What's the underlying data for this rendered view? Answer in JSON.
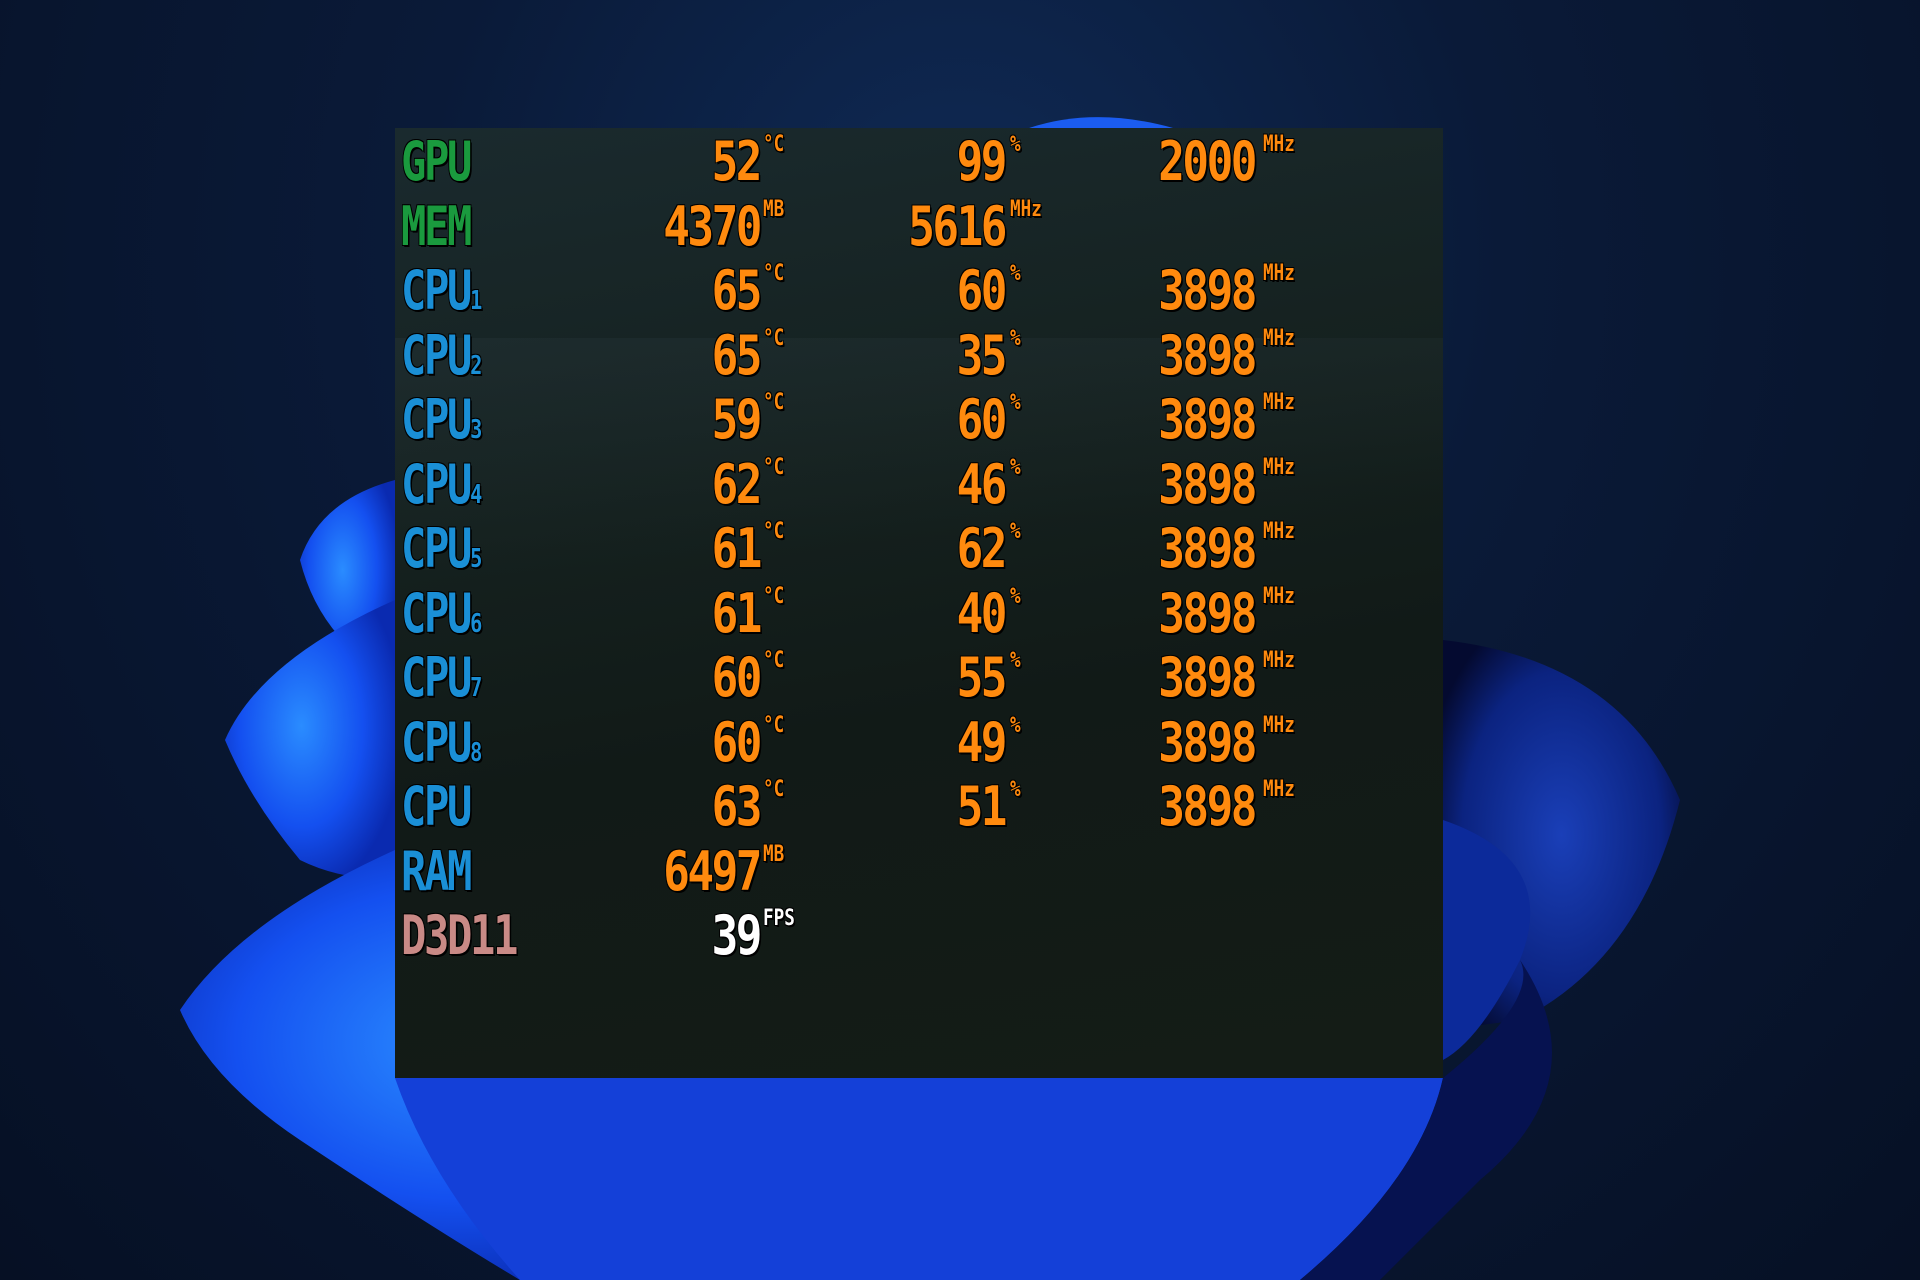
{
  "colors": {
    "gpu_label": "#1a9a3e",
    "cpu_label": "#1a8fd6",
    "api_label": "#c98a86",
    "value": "#ff8a0e",
    "fps_value": "#ffffff"
  },
  "overlay": {
    "rows": [
      {
        "label": "GPU",
        "sub": "",
        "v1": "52",
        "u1": "°C",
        "v2": "99",
        "u2": "%",
        "v3": "2000",
        "u3": "MHz",
        "color": "green"
      },
      {
        "label": "MEM",
        "sub": "",
        "v1": "4370",
        "u1": "MB",
        "v2": "5616",
        "u2": "MHz",
        "v3": "",
        "u3": "",
        "color": "green"
      },
      {
        "label": "CPU",
        "sub": "1",
        "v1": "65",
        "u1": "°C",
        "v2": "60",
        "u2": "%",
        "v3": "3898",
        "u3": "MHz",
        "color": "blue"
      },
      {
        "label": "CPU",
        "sub": "2",
        "v1": "65",
        "u1": "°C",
        "v2": "35",
        "u2": "%",
        "v3": "3898",
        "u3": "MHz",
        "color": "blue"
      },
      {
        "label": "CPU",
        "sub": "3",
        "v1": "59",
        "u1": "°C",
        "v2": "60",
        "u2": "%",
        "v3": "3898",
        "u3": "MHz",
        "color": "blue"
      },
      {
        "label": "CPU",
        "sub": "4",
        "v1": "62",
        "u1": "°C",
        "v2": "46",
        "u2": "%",
        "v3": "3898",
        "u3": "MHz",
        "color": "blue"
      },
      {
        "label": "CPU",
        "sub": "5",
        "v1": "61",
        "u1": "°C",
        "v2": "62",
        "u2": "%",
        "v3": "3898",
        "u3": "MHz",
        "color": "blue"
      },
      {
        "label": "CPU",
        "sub": "6",
        "v1": "61",
        "u1": "°C",
        "v2": "40",
        "u2": "%",
        "v3": "3898",
        "u3": "MHz",
        "color": "blue"
      },
      {
        "label": "CPU",
        "sub": "7",
        "v1": "60",
        "u1": "°C",
        "v2": "55",
        "u2": "%",
        "v3": "3898",
        "u3": "MHz",
        "color": "blue"
      },
      {
        "label": "CPU",
        "sub": "8",
        "v1": "60",
        "u1": "°C",
        "v2": "49",
        "u2": "%",
        "v3": "3898",
        "u3": "MHz",
        "color": "blue"
      },
      {
        "label": "CPU",
        "sub": "",
        "v1": "63",
        "u1": "°C",
        "v2": "51",
        "u2": "%",
        "v3": "3898",
        "u3": "MHz",
        "color": "blue"
      },
      {
        "label": "RAM",
        "sub": "",
        "v1": "6497",
        "u1": "MB",
        "v2": "",
        "u2": "",
        "v3": "",
        "u3": "",
        "color": "blue"
      },
      {
        "label": "D3D11",
        "sub": "",
        "v1": "39",
        "u1": "FPS",
        "v2": "",
        "u2": "",
        "v3": "",
        "u3": "",
        "color": "pink"
      }
    ]
  }
}
